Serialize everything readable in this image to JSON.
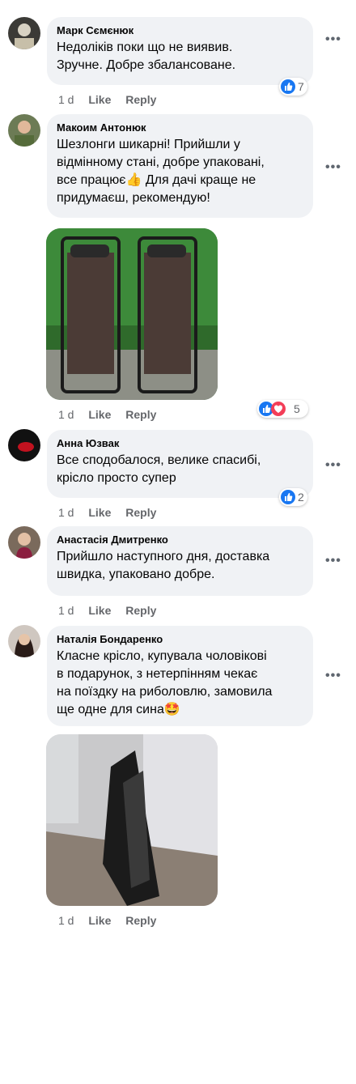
{
  "comments": [
    {
      "author": "Марк Сємєнюк",
      "text": "Недоліків поки що не виявив.\nЗручне. Добре збалансоване.",
      "time": "1 d",
      "like": "Like",
      "reply": "Reply",
      "reaction_count": "7",
      "reactions": [
        "like-icon"
      ]
    },
    {
      "author": "Макоим Антонюк",
      "text": "Шезлонги шикарні! Прийшли у\nвідмінному стані, добре упаковані,\nвсе працює👍 Для дачі краще не\nпридумаєш, рекомендую!",
      "time": "1 d",
      "like": "Like",
      "reply": "Reply",
      "reaction_count": "5",
      "reactions": [
        "like-icon",
        "love-icon"
      ]
    },
    {
      "author": "Анна Юзвак",
      "text": "Все сподобалося, велике спасибі,\nкрісло просто супер",
      "time": "1 d",
      "like": "Like",
      "reply": "Reply",
      "reaction_count": "2",
      "reactions": [
        "like-icon"
      ]
    },
    {
      "author": "Анастасія Дмитренко",
      "text": "Прийшло наступного дня, доставка\nшвидка, упаковано добре.",
      "time": "1 d",
      "like": "Like",
      "reply": "Reply"
    },
    {
      "author": "Наталія Бондаренко",
      "text": "Класне крісло, купувала чоловікові\nв подарунок, з нетерпінням чекає\nна поїздку на риболовлю, замовила\nще одне для сина🤩",
      "time": "1 d",
      "like": "Like",
      "reply": "Reply"
    }
  ],
  "more_glyph": "•••",
  "colors": {
    "bubble": "#f0f2f5",
    "meta": "#65676b",
    "like": "#1877f2",
    "love": "#f33e58"
  }
}
